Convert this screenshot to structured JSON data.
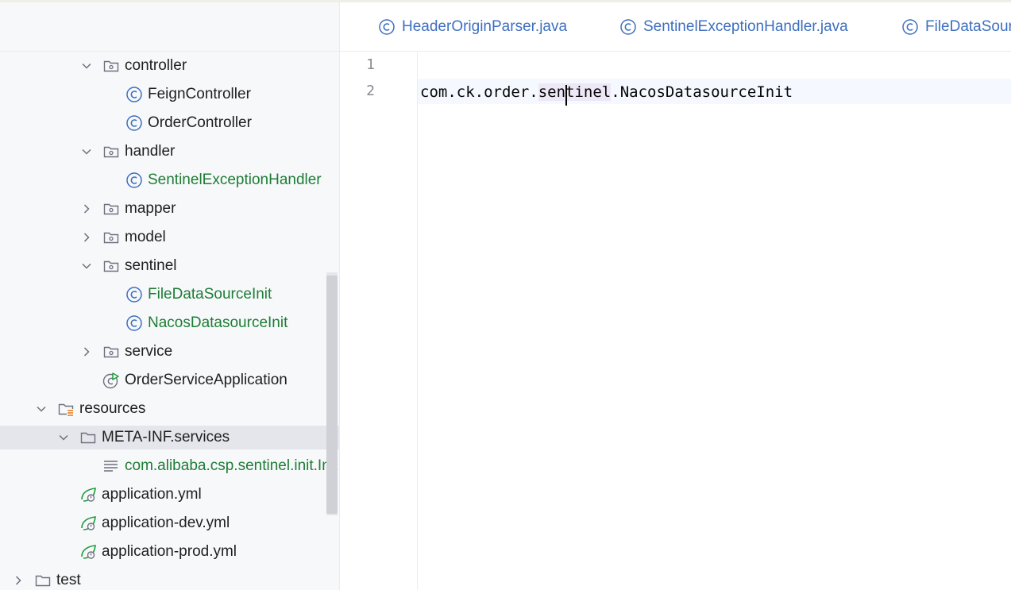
{
  "tabs": [
    {
      "label": "HeaderOriginParser.java"
    },
    {
      "label": "SentinelExceptionHandler.java"
    },
    {
      "label": "FileDataSour"
    }
  ],
  "tree": {
    "items": [
      {
        "label": "controller"
      },
      {
        "label": "FeignController"
      },
      {
        "label": "OrderController"
      },
      {
        "label": "handler"
      },
      {
        "label": "SentinelExceptionHandler"
      },
      {
        "label": "mapper"
      },
      {
        "label": "model"
      },
      {
        "label": "sentinel"
      },
      {
        "label": "FileDataSourceInit"
      },
      {
        "label": "NacosDatasourceInit"
      },
      {
        "label": "service"
      },
      {
        "label": "OrderServiceApplication"
      },
      {
        "label": "resources"
      },
      {
        "label": "META-INF.services"
      },
      {
        "label": "com.alibaba.csp.sentinel.init.Init"
      },
      {
        "label": "application.yml"
      },
      {
        "label": "application-dev.yml"
      },
      {
        "label": "application-prod.yml"
      },
      {
        "label": "test"
      }
    ]
  },
  "editor": {
    "line_numbers": [
      "1",
      "2"
    ],
    "code": {
      "before": "com.ck.order.",
      "hl_a": "sen",
      "hl_b": "tinel",
      "after": ".NacosDatasourceInit"
    }
  },
  "colors": {
    "class_icon": "#3d6fbf",
    "vcs_added": "#1d7d35",
    "resources_accent": "#e8710a"
  }
}
